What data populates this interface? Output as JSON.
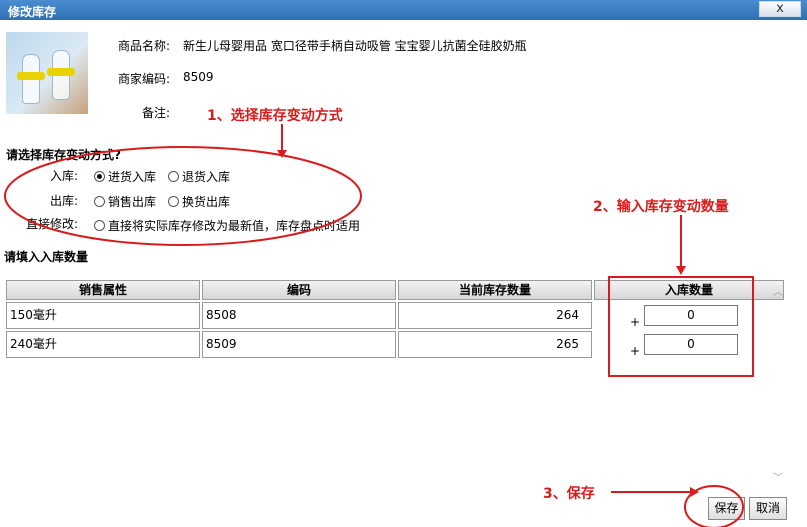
{
  "dialog": {
    "title": "修改库存",
    "close_glyph": "x"
  },
  "product": {
    "name_label": "商品名称:",
    "name_value": "新生儿母婴用品 宽口径带手柄自动吸管 宝宝婴儿抗菌全硅胶奶瓶",
    "code_label": "商家编码:",
    "code_value": "8509",
    "note_label": "备注:"
  },
  "mode": {
    "heading": "请选择库存变动方式?",
    "rows": [
      {
        "label": "入库:",
        "options": [
          "进货入库",
          "退货入库"
        ]
      },
      {
        "label": "出库:",
        "options": [
          "销售出库",
          "换货出库"
        ]
      },
      {
        "label": "直接修改:",
        "options": [
          "直接将实际库存修改为最新值，库存盘点时适用"
        ]
      }
    ],
    "selected": "进货入库"
  },
  "table": {
    "heading": "请填入入库数量",
    "columns": [
      "销售属性",
      "编码",
      "当前库存数量",
      "入库数量"
    ],
    "rows": [
      {
        "attr": "150毫升",
        "code": "8508",
        "stock": "264",
        "plus": "+",
        "qty": "0"
      },
      {
        "attr": "240毫升",
        "code": "8509",
        "stock": "265",
        "plus": "+",
        "qty": "0"
      }
    ]
  },
  "buttons": {
    "save": "保存",
    "cancel": "取消"
  },
  "annotations": {
    "step1": "1、选择库存变动方式",
    "step2": "2、输入库存变动数量",
    "step3": "3、保存",
    "color": "#d81c1c"
  },
  "scrollbar": {
    "up_icon": "chevron-up-icon",
    "down_icon": "chevron-down-icon"
  }
}
